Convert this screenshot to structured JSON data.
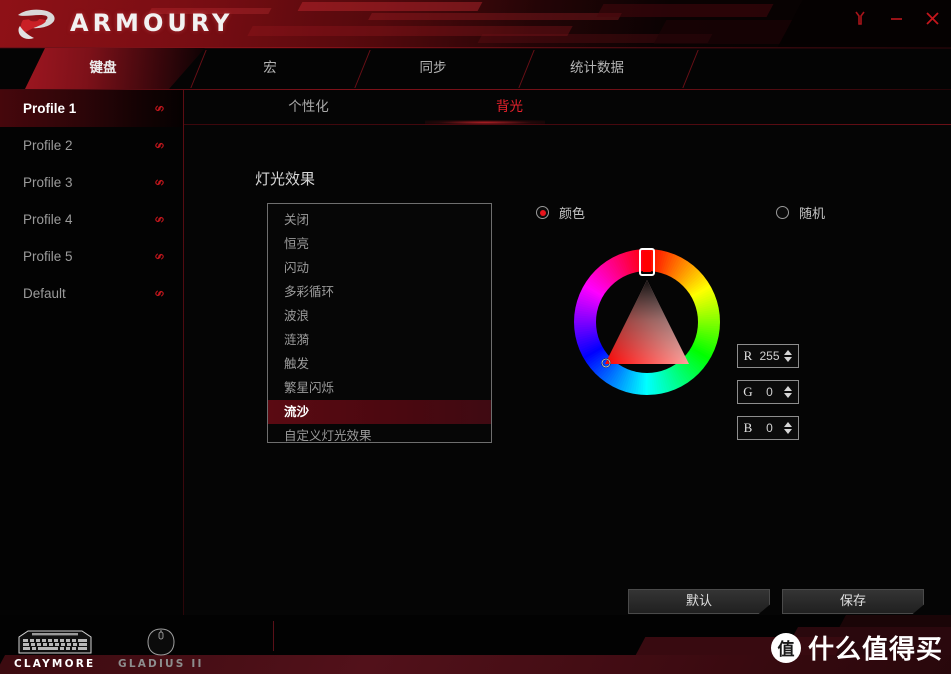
{
  "app": {
    "brand": "ARMOURY",
    "logo_icon": "rog-eye-logo"
  },
  "window_controls": {
    "settings_icon": "wrench-icon",
    "minimize_icon": "minimize-icon",
    "close_icon": "close-icon"
  },
  "main_tabs": [
    {
      "label": "键盘",
      "active": true,
      "name": "tab-keyboard"
    },
    {
      "label": "宏",
      "active": false,
      "name": "tab-macro"
    },
    {
      "label": "同步",
      "active": false,
      "name": "tab-sync"
    },
    {
      "label": "统计数据",
      "active": false,
      "name": "tab-statistics"
    }
  ],
  "sidebar": {
    "profiles": [
      {
        "label": "Profile 1",
        "active": true,
        "link_icon": "link-icon"
      },
      {
        "label": "Profile 2",
        "active": false,
        "link_icon": "link-icon"
      },
      {
        "label": "Profile 3",
        "active": false,
        "link_icon": "link-icon"
      },
      {
        "label": "Profile 4",
        "active": false,
        "link_icon": "link-icon"
      },
      {
        "label": "Profile 5",
        "active": false,
        "link_icon": "link-icon"
      },
      {
        "label": "Default",
        "active": false,
        "link_icon": "link-icon"
      }
    ]
  },
  "sub_tabs": [
    {
      "label": "个性化",
      "active": false,
      "name": "subtab-personalize"
    },
    {
      "label": "背光",
      "active": true,
      "name": "subtab-backlight"
    }
  ],
  "content": {
    "section_title": "灯光效果",
    "effects": [
      {
        "label": "关闭",
        "selected": false
      },
      {
        "label": "恒亮",
        "selected": false
      },
      {
        "label": "闪动",
        "selected": false
      },
      {
        "label": "多彩循环",
        "selected": false
      },
      {
        "label": "波浪",
        "selected": false
      },
      {
        "label": "涟漪",
        "selected": false
      },
      {
        "label": "触发",
        "selected": false
      },
      {
        "label": "繁星闪烁",
        "selected": false
      },
      {
        "label": "流沙",
        "selected": true
      },
      {
        "label": "自定义灯光效果",
        "selected": false
      }
    ],
    "color_mode": {
      "color_label": "颜色",
      "color_selected": true,
      "random_label": "随机",
      "random_selected": false
    },
    "color_picker": {
      "hue_degrees": 0,
      "selected_hex": "#ff0000",
      "marker_icon": "color-marker-icon",
      "hue_handle_icon": "hue-handle-icon"
    },
    "rgb": [
      {
        "channel": "R",
        "value": "255"
      },
      {
        "channel": "G",
        "value": "0"
      },
      {
        "channel": "B",
        "value": "0"
      }
    ],
    "buttons": {
      "default_label": "默认",
      "save_label": "保存"
    }
  },
  "device_bar": {
    "devices": [
      {
        "label": "CLAYMORE",
        "icon": "keyboard-icon",
        "active": true
      },
      {
        "label": "GLADIUS II",
        "icon": "mouse-icon",
        "active": false
      }
    ]
  },
  "watermark": {
    "badge": "值",
    "text": "什么值得买"
  },
  "colors": {
    "accent_red": "#e8141c",
    "header_red": "#961218",
    "panel_black": "#050505",
    "selected_red": "#ff0000"
  }
}
